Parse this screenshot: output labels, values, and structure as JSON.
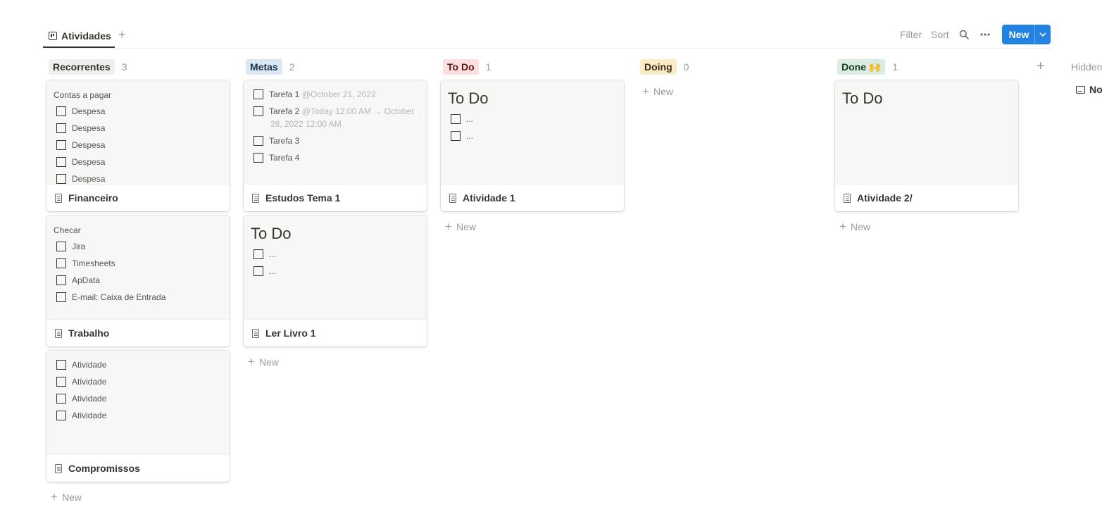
{
  "view": {
    "tab_label": "Atividades",
    "add_view": "+"
  },
  "toolbar": {
    "filter": "Filter",
    "sort": "Sort",
    "new_label": "New",
    "chevron": "⌄"
  },
  "columns": [
    {
      "name": "Recorrentes",
      "count": "3",
      "color": "#efefed",
      "text_color": "#37352f"
    },
    {
      "name": "Metas",
      "count": "2",
      "color": "#dbe8f3",
      "text_color": "#183347"
    },
    {
      "name": "To Do",
      "count": "1",
      "color": "#fddfe0",
      "text_color": "#5d1715"
    },
    {
      "name": "Doing",
      "count": "0",
      "color": "#fbecc8",
      "text_color": "#402c1b"
    },
    {
      "name": "Done 🙌",
      "count": "1",
      "color": "#dbede1",
      "text_color": "#1c3829"
    }
  ],
  "cards": {
    "financeiro": {
      "title": "Financeiro",
      "heading": "Contas a pagar",
      "todos": [
        "Despesa",
        "Despesa",
        "Despesa",
        "Despesa",
        "Despesa"
      ]
    },
    "trabalho": {
      "title": "Trabalho",
      "heading": "Checar",
      "todos": [
        "Jira",
        "Timesheets",
        "ApData",
        "E-mail: Caixa de Entrada"
      ]
    },
    "compromissos": {
      "title": "Compromissos",
      "todos": [
        "Atividade",
        "Atividade",
        "Atividade",
        "Atividade"
      ]
    },
    "estudos": {
      "title": "Estudos Tema 1",
      "todos": [
        {
          "label": "Tarefa 1",
          "date": "@October 21, 2022"
        },
        {
          "label": "Tarefa 2",
          "date": "@Today 12:00 AM → October",
          "date2": "28, 2022 12:00 AM"
        },
        {
          "label": "Tarefa 3"
        },
        {
          "label": "Tarefa 4"
        }
      ]
    },
    "ler_livro": {
      "title": "Ler Livro 1",
      "heading": "To Do",
      "todos": [
        "...",
        "..."
      ]
    },
    "atividade1": {
      "title": "Atividade 1",
      "heading": "To Do",
      "todos": [
        "...",
        "..."
      ]
    },
    "atividade2": {
      "title": "Atividade 2/",
      "heading": "To Do"
    }
  },
  "add_new_label": "New",
  "hidden": {
    "label": "Hidden",
    "item": "No"
  }
}
